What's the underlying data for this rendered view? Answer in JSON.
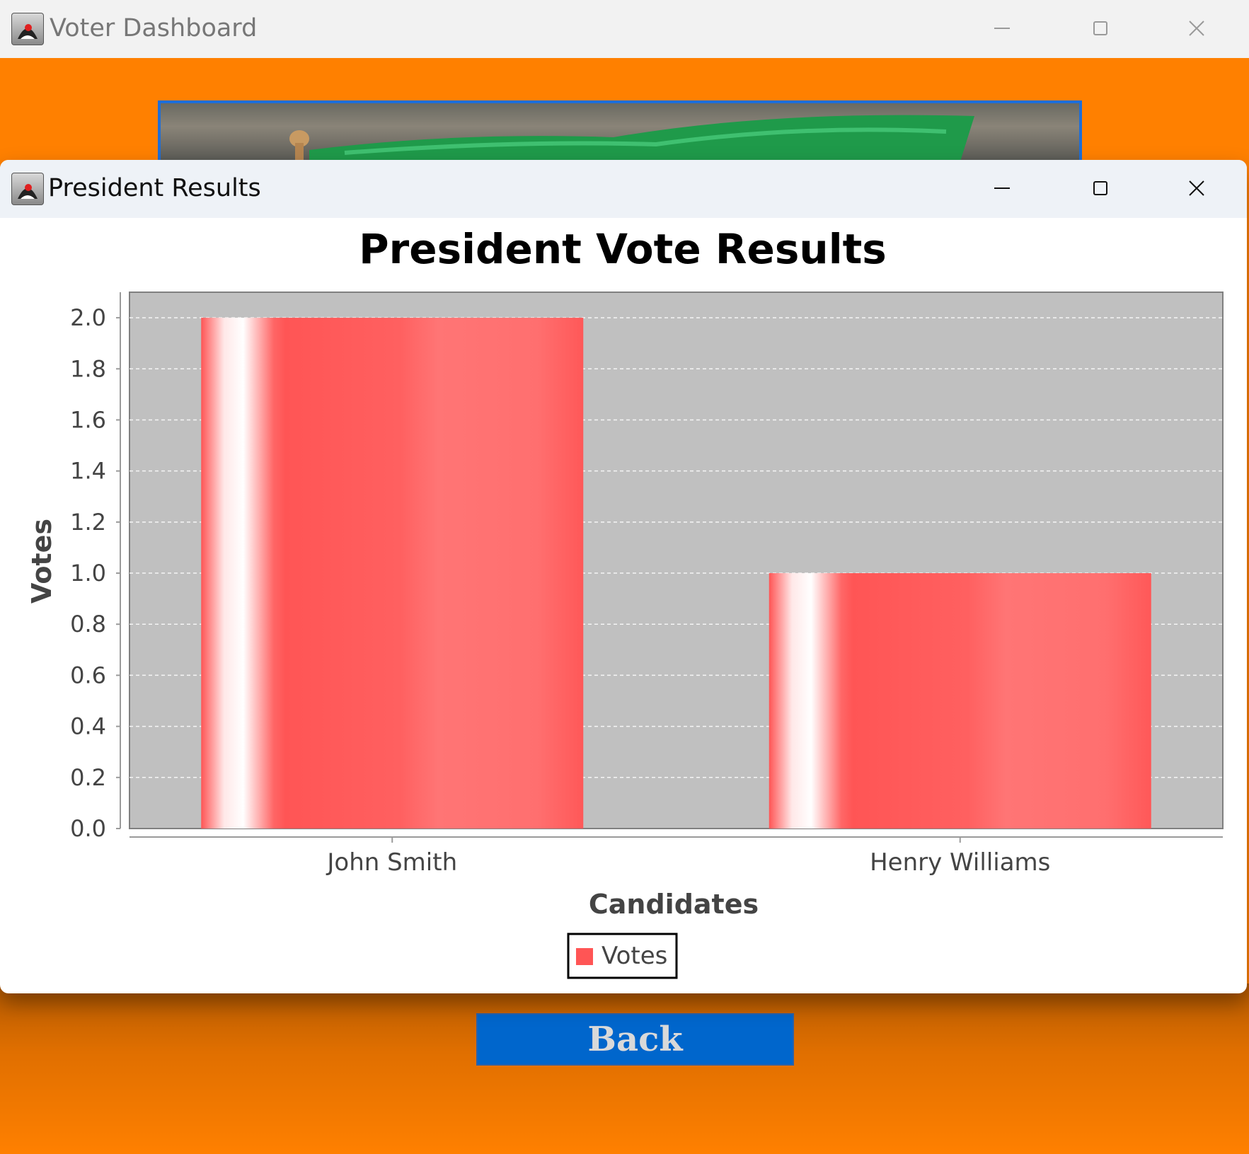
{
  "dashboard_window": {
    "title": "Voter Dashboard",
    "back_label": "Back",
    "colors": {
      "background": "#ff8000",
      "back_button": "#0066cc"
    }
  },
  "results_window": {
    "title": "President Results"
  },
  "chart_data": {
    "type": "bar",
    "title": "President Vote Results",
    "xlabel": "Candidates",
    "ylabel": "Votes",
    "categories": [
      "John Smith",
      "Henry Williams"
    ],
    "series": [
      {
        "name": "Votes",
        "values": [
          2,
          1
        ],
        "color": "#ff5555"
      }
    ],
    "ylim": [
      0,
      2.1
    ],
    "yticks": [
      "0.0",
      "0.2",
      "0.4",
      "0.6",
      "0.8",
      "1.0",
      "1.2",
      "1.4",
      "1.6",
      "1.8",
      "2.0"
    ],
    "grid": true,
    "legend": "bottom-center",
    "plot_background": "#c0c0c0"
  }
}
